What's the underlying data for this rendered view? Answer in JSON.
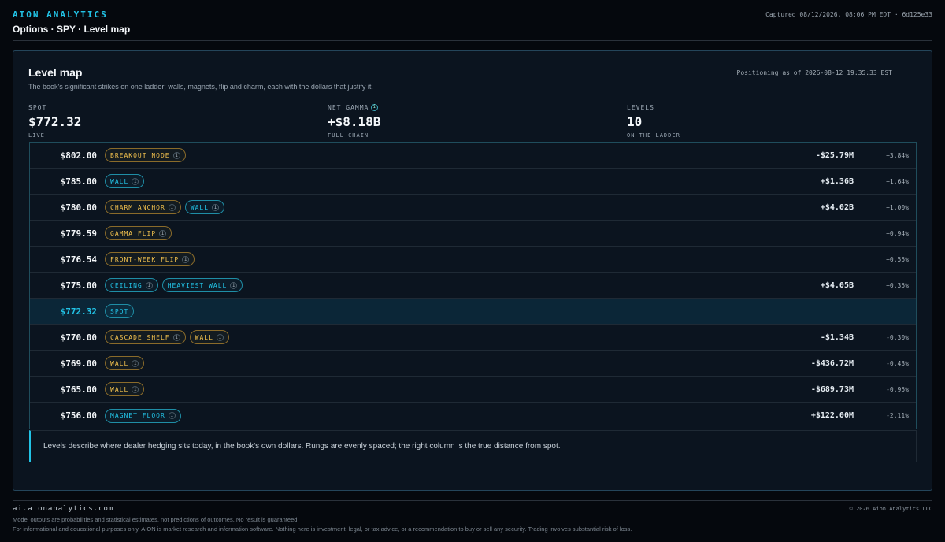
{
  "header": {
    "brand": "AION ANALYTICS",
    "breadcrumb": "Options · SPY · Level map",
    "captured": "Captured 08/12/2026, 08:06 PM EDT · 6d125e33"
  },
  "card": {
    "title": "Level map",
    "subtitle": "The book's significant strikes on one ladder: walls, magnets, flip and charm, each with the dollars that justify it.",
    "as_of": "Positioning as of 2026-08-12 19:35:33 EST"
  },
  "stats": {
    "spot": {
      "label": "SPOT",
      "value": "$772.32",
      "sub": "LIVE"
    },
    "net_gamma": {
      "label": "NET GAMMA",
      "value": "+$8.18B",
      "sub": "FULL CHAIN"
    },
    "levels": {
      "label": "LEVELS",
      "value": "10",
      "sub": "ON THE LADDER"
    }
  },
  "ladder": [
    {
      "price": "$802.00",
      "tags": [
        {
          "label": "BREAKOUT NODE",
          "color": "gold"
        }
      ],
      "amount": "-$25.79M",
      "pct": "+3.84%"
    },
    {
      "price": "$785.00",
      "tags": [
        {
          "label": "WALL",
          "color": "cyan"
        }
      ],
      "amount": "+$1.36B",
      "pct": "+1.64%"
    },
    {
      "price": "$780.00",
      "tags": [
        {
          "label": "CHARM ANCHOR",
          "color": "gold"
        },
        {
          "label": "WALL",
          "color": "cyan"
        }
      ],
      "amount": "+$4.02B",
      "pct": "+1.00%"
    },
    {
      "price": "$779.59",
      "tags": [
        {
          "label": "GAMMA FLIP",
          "color": "gold"
        }
      ],
      "amount": "",
      "pct": "+0.94%"
    },
    {
      "price": "$776.54",
      "tags": [
        {
          "label": "FRONT-WEEK FLIP",
          "color": "gold"
        }
      ],
      "amount": "",
      "pct": "+0.55%"
    },
    {
      "price": "$775.00",
      "tags": [
        {
          "label": "CEILING",
          "color": "cyan"
        },
        {
          "label": "HEAVIEST WALL",
          "color": "cyan"
        }
      ],
      "amount": "+$4.05B",
      "pct": "+0.35%"
    },
    {
      "price": "$772.32",
      "tags": [
        {
          "label": "SPOT",
          "color": "cyan",
          "noinfo": true
        }
      ],
      "amount": "",
      "pct": "",
      "spot": true
    },
    {
      "price": "$770.00",
      "tags": [
        {
          "label": "CASCADE SHELF",
          "color": "gold"
        },
        {
          "label": "WALL",
          "color": "gold"
        }
      ],
      "amount": "-$1.34B",
      "pct": "-0.30%"
    },
    {
      "price": "$769.00",
      "tags": [
        {
          "label": "WALL",
          "color": "gold"
        }
      ],
      "amount": "-$436.72M",
      "pct": "-0.43%"
    },
    {
      "price": "$765.00",
      "tags": [
        {
          "label": "WALL",
          "color": "gold"
        }
      ],
      "amount": "-$689.73M",
      "pct": "-0.95%"
    },
    {
      "price": "$756.00",
      "tags": [
        {
          "label": "MAGNET FLOOR",
          "color": "cyan"
        }
      ],
      "amount": "+$122.00M",
      "pct": "-2.11%"
    }
  ],
  "info_glyph": "i",
  "note": "Levels describe where dealer hedging sits today, in the book's own dollars. Rungs are evenly spaced; the right column is the true distance from spot.",
  "footer": {
    "site": "ai.aionanalytics.com",
    "copyright": "© 2026 Aion Analytics LLC",
    "line1": "Model outputs are probabilities and statistical estimates, not predictions of outcomes. No result is guaranteed.",
    "line2": "For informational and educational purposes only. AION is market research and information software. Nothing here is investment, legal, or tax advice, or a recommendation to buy or sell any security. Trading involves substantial risk of loss."
  },
  "colors": {
    "accent": "#22c3e6",
    "gold": "#f2c14e",
    "background": "#05080d",
    "card": "#0b141f"
  }
}
